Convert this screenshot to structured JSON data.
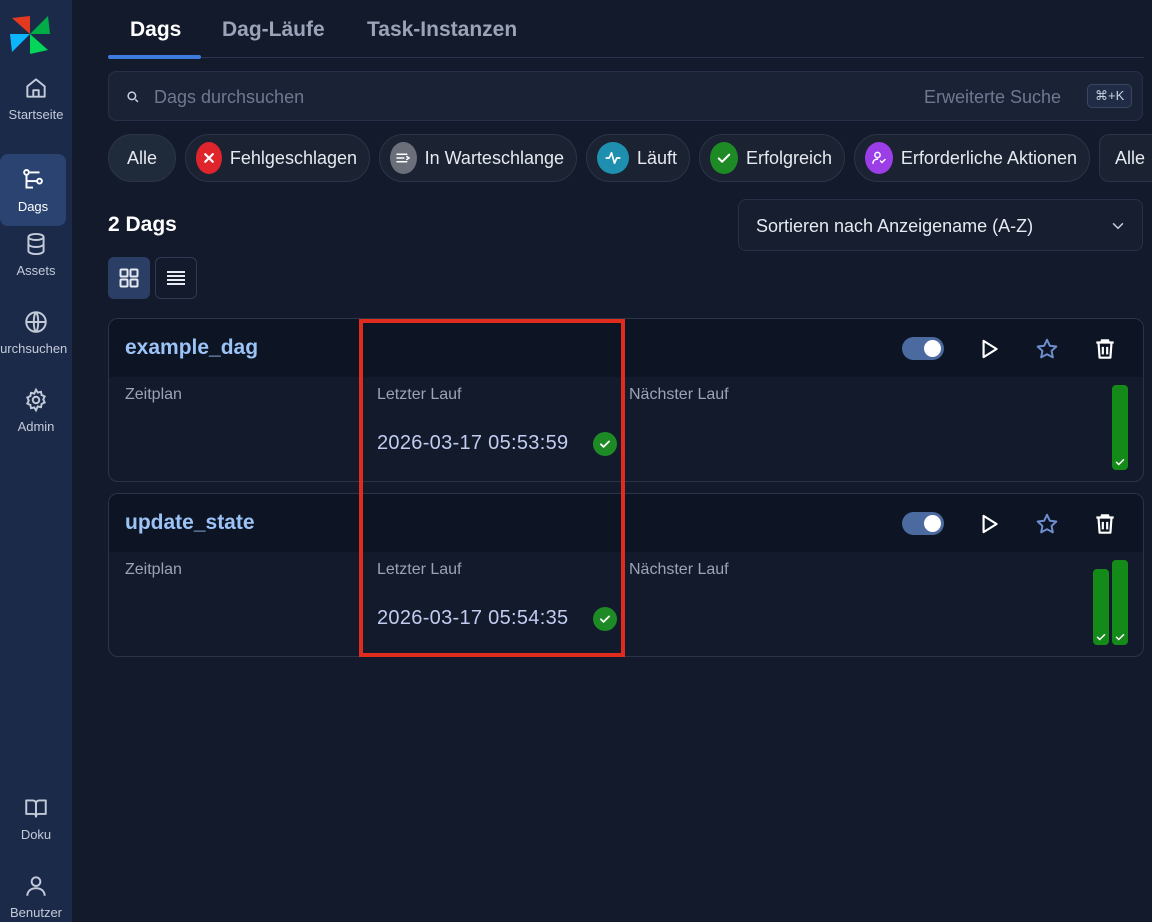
{
  "sidebar": {
    "items": [
      {
        "label": "Startseite",
        "icon": "home-icon"
      },
      {
        "label": "Dags",
        "icon": "dags-icon",
        "active": true
      },
      {
        "label": "Assets",
        "icon": "database-icon"
      },
      {
        "label": "Durchsuchen",
        "icon": "globe-icon"
      },
      {
        "label": "Admin",
        "icon": "gear-icon"
      }
    ],
    "bottom_items": [
      {
        "label": "Doku",
        "icon": "book-icon"
      },
      {
        "label": "Benutzer",
        "icon": "user-icon"
      }
    ]
  },
  "tabs": [
    {
      "label": "Dags",
      "active": true
    },
    {
      "label": "Dag-Läufe"
    },
    {
      "label": "Task-Instanzen"
    }
  ],
  "search": {
    "placeholder": "Dags durchsuchen",
    "advanced_label": "Erweiterte Suche",
    "shortcut": "⌘+K"
  },
  "filters": [
    {
      "label": "Alle"
    },
    {
      "label": "Fehlgeschlagen",
      "color": "#e0242c"
    },
    {
      "label": "In Warteschlange",
      "color": "#6b6f7a"
    },
    {
      "label": "Läuft",
      "color": "#1f8fb0"
    },
    {
      "label": "Erfolgreich",
      "color": "#1e8a25"
    },
    {
      "label": "Erforderliche Aktionen",
      "color": "#9b3ee8"
    },
    {
      "label": "Alle"
    }
  ],
  "dag_count": "2 Dags",
  "sort": {
    "label": "Sortieren nach Anzeigename (A-Z)"
  },
  "labels": {
    "schedule": "Zeitplan",
    "last_run": "Letzter Lauf",
    "next_run": "Nächster Lauf"
  },
  "dags": [
    {
      "name": "example_dag",
      "last_run": "2026-03-17 05:53:59",
      "enabled": true,
      "recent_runs": [
        "success"
      ]
    },
    {
      "name": "update_state",
      "last_run": "2026-03-17 05:54:35",
      "enabled": true,
      "recent_runs": [
        "success",
        "success"
      ]
    }
  ],
  "colors": {
    "accent": "#3d7bdc",
    "success": "#1e8a25",
    "highlight": "#e02b1f"
  }
}
